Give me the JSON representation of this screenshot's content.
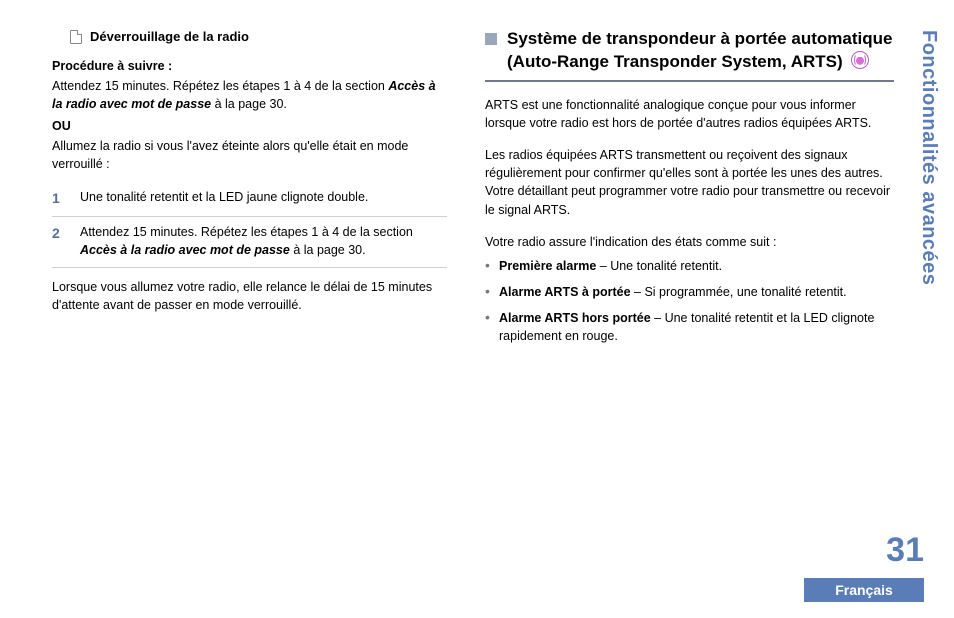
{
  "sideTab": "Fonctionnalités avancées",
  "pageNumber": "31",
  "language": "Français",
  "left": {
    "subheading": "Déverrouillage de la radio",
    "procedureLabel": "Procédure à suivre :",
    "line1a": "Attendez 15 minutes. Répétez les étapes 1 à 4 de la section ",
    "line1_link": "Accès à la radio avec mot de passe",
    "line1b": " à la page 30.",
    "orLabel": "OU",
    "line2": "Allumez la radio si vous l'avez éteinte alors qu'elle était en mode verrouillé :",
    "steps": [
      {
        "n": "1",
        "text": "Une tonalité retentit et la LED jaune clignote double."
      },
      {
        "n": "2",
        "text_a": "Attendez 15 minutes. Répétez les étapes 1 à 4 de la section ",
        "text_link": "Accès à la radio avec mot de passe",
        "text_b": " à la page 30."
      }
    ],
    "footer": "Lorsque vous allumez votre radio, elle relance le délai de 15 minutes d'attente avant de passer en mode verrouillé."
  },
  "right": {
    "heading": "Système de transpondeur à portée automatique (Auto-Range Transponder System, ARTS)",
    "iconName": "radio-signal-icon",
    "p1": "ARTS est une fonctionnalité analogique conçue pour vous informer lorsque votre radio est hors de portée d'autres radios équipées ARTS.",
    "p2": "Les radios équipées ARTS transmettent ou reçoivent des signaux régulièrement pour confirmer qu'elles sont à portée les unes des autres. Votre détaillant peut programmer votre radio pour transmettre ou recevoir le signal ARTS.",
    "p3": "Votre radio assure l'indication des états comme suit :",
    "bullets": [
      {
        "label": "Première alarme",
        "sep": " – ",
        "text": "Une tonalité retentit."
      },
      {
        "label": "Alarme ARTS à portée",
        "sep": " – ",
        "text": "Si programmée, une tonalité retentit."
      },
      {
        "label": "Alarme ARTS hors portée",
        "sep": " – ",
        "text": "Une tonalité retentit et la LED clignote rapidement en rouge."
      }
    ]
  }
}
